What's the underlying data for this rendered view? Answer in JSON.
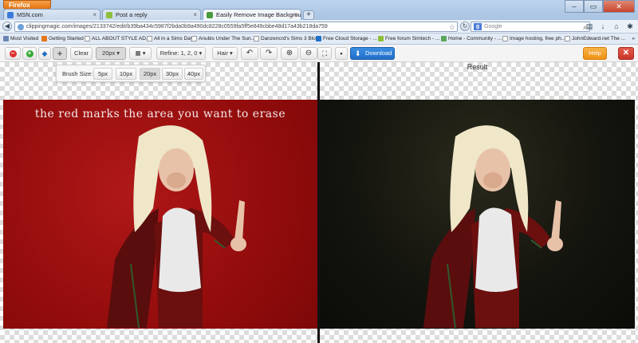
{
  "browser": {
    "menu_button": "Firefox",
    "tabs": [
      {
        "label": "MSN.com"
      },
      {
        "label": "Post a reply"
      },
      {
        "label": "Easily Remove Image Backgrounds O..."
      }
    ],
    "new_tab": "+",
    "url": "clippingmagic.com/images/2133742/edit/b39ba434c5987f2bda0b9a490dc8228c0559fa5ff5e849cbbe48d17a43b218da759",
    "search_placeholder": "Google"
  },
  "bookmarks": [
    {
      "label": "Most Visited"
    },
    {
      "label": "Getting Started"
    },
    {
      "label": "ALL ABOUT STYLE AD..."
    },
    {
      "label": "All in a Sims Day"
    },
    {
      "label": "Anubis Under The Sun..."
    },
    {
      "label": "Danzencrd's Sims 3 Blo..."
    },
    {
      "label": "Free Cloud Storage - ..."
    },
    {
      "label": "Free forum Simtech - ..."
    },
    {
      "label": "Home - Community - ..."
    },
    {
      "label": "Image hosting, free ph..."
    },
    {
      "label": "JohnEdward.net The ..."
    }
  ],
  "toolbar": {
    "clear": "Clear",
    "brush_value": "20px",
    "refine_label": "Refine: 1, 2, 0",
    "hair_label": "Hair",
    "download": "Download",
    "help": "Help",
    "close": "✕"
  },
  "brush_popover": {
    "label": "Brush Size:",
    "options": [
      "5px",
      "10px",
      "20px",
      "30px",
      "40px"
    ],
    "selected": "20px"
  },
  "editor": {
    "caption": "the red marks the area you want to erase",
    "result_label": "Result"
  },
  "colors": {
    "accent_blue": "#1f6fc8",
    "help_orange": "#ef9312",
    "close_red": "#c9352a",
    "erase_red": "#9e1010"
  }
}
